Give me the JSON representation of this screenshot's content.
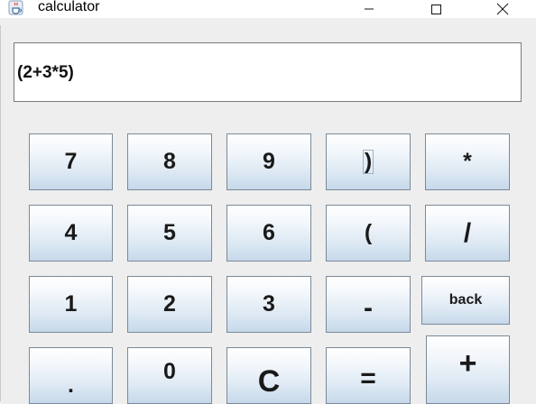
{
  "window": {
    "title": "calculator",
    "app_icon": "java-cup-icon",
    "controls": {
      "minimize_icon": "minimize-icon",
      "maximize_icon": "maximize-icon",
      "close_icon": "close-icon"
    }
  },
  "display": {
    "value": "(2+3*5)"
  },
  "keys": {
    "k7": "7",
    "k8": "8",
    "k9": "9",
    "rparen": ")",
    "multiply": "*",
    "k4": "4",
    "k5": "5",
    "k6": "6",
    "lparen": "(",
    "divide": "/",
    "k1": "1",
    "k2": "2",
    "k3": "3",
    "minus": "-",
    "back": "back",
    "dot": ".",
    "k0": "0",
    "clear": "C",
    "equals": "=",
    "plus": "+"
  },
  "colors": {
    "window_bg": "#eeeeee",
    "key_gradient_top": "#ffffff",
    "key_gradient_bottom": "#c6d8ea",
    "key_border": "#7a8a99"
  }
}
